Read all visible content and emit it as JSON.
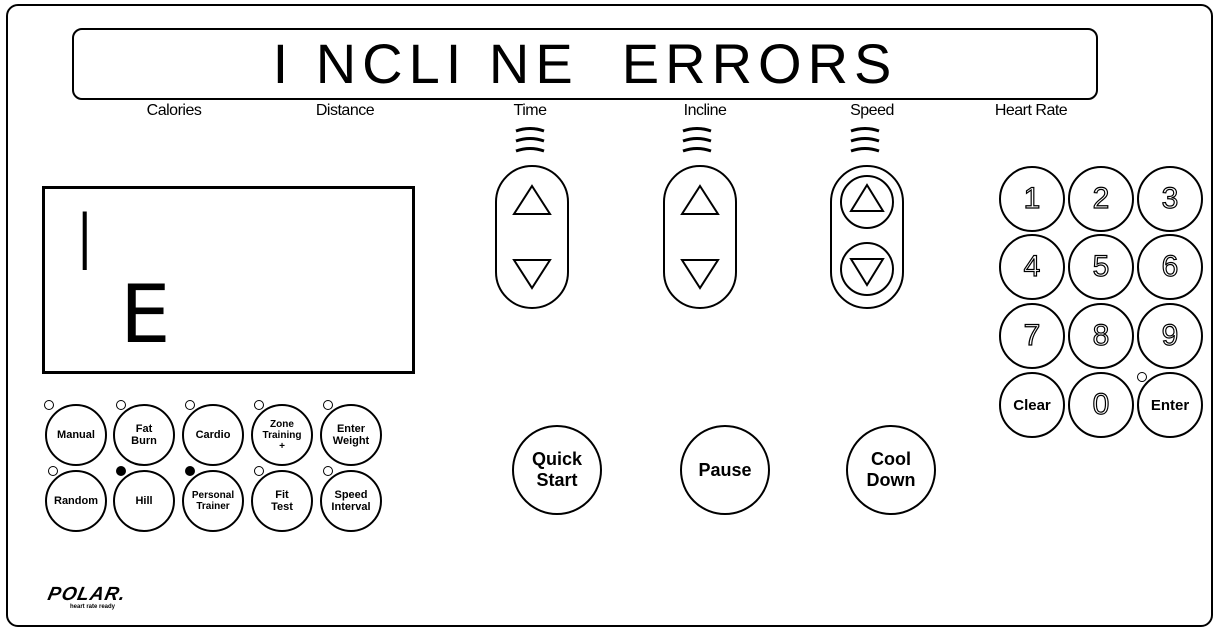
{
  "display": {
    "message": "I NCLI NE  ERRORS",
    "lcd_line1": "I",
    "lcd_line2": "E"
  },
  "labels": [
    "Calories",
    "Distance",
    "Time",
    "Incline",
    "Speed",
    "Heart Rate"
  ],
  "programs": [
    {
      "label": "Manual",
      "led": "off"
    },
    {
      "label": "Fat\nBurn",
      "led": "off"
    },
    {
      "label": "Cardio",
      "led": "off"
    },
    {
      "label": "Zone\nTraining\n+",
      "led": "off"
    },
    {
      "label": "Enter\nWeight",
      "led": "off"
    },
    {
      "label": "Random",
      "led": "off"
    },
    {
      "label": "Hill",
      "led": "on"
    },
    {
      "label": "Personal\nTrainer",
      "led": "on"
    },
    {
      "label": "Fit\nTest",
      "led": "off"
    },
    {
      "label": "Speed\nInterval",
      "led": "off"
    }
  ],
  "controls": {
    "quick_start": "Quick\nStart",
    "pause": "Pause",
    "cool_down": "Cool\nDown"
  },
  "keypad": [
    "1",
    "2",
    "3",
    "4",
    "5",
    "6",
    "7",
    "8",
    "9",
    "Clear",
    "0",
    "Enter"
  ],
  "brand": {
    "logo": "POLAR.",
    "tagline": "heart rate ready"
  }
}
